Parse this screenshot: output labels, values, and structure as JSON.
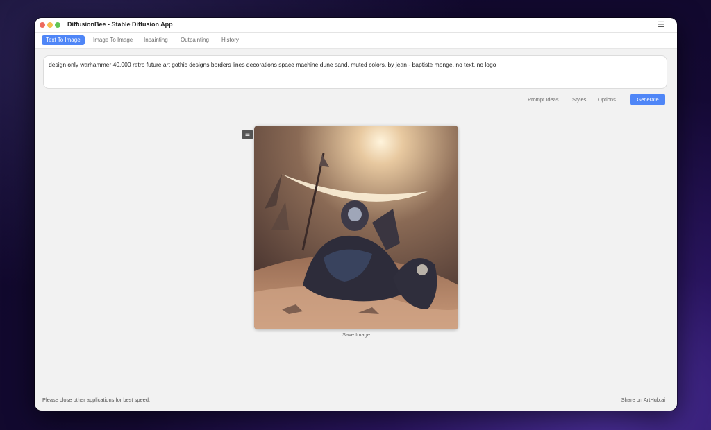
{
  "window": {
    "title": "DiffusionBee - Stable Diffusion App"
  },
  "tabs": [
    {
      "label": "Text To Image",
      "active": true
    },
    {
      "label": "Image To Image"
    },
    {
      "label": "Inpainting"
    },
    {
      "label": "Outpainting"
    },
    {
      "label": "History"
    }
  ],
  "prompt": {
    "text": "design only warhammer 40.000 retro future art gothic designs borders lines decorations space machine dune sand. muted colors. by jean - baptiste monge, no text, no logo"
  },
  "actions": {
    "prompt_ideas": "Prompt Ideas",
    "styles": "Styles",
    "options": "Options",
    "generate": "Generate"
  },
  "image_panel": {
    "menu_icon": "hamburger-icon",
    "save_label": "Save Image"
  },
  "footer": {
    "hint": "Please close other applications for best speed.",
    "share": "Share on ArtHub.ai"
  },
  "colors": {
    "accent": "#4f86f7",
    "close": "#ed6a5e",
    "minimize": "#f4bf4f",
    "zoom": "#61c554"
  }
}
